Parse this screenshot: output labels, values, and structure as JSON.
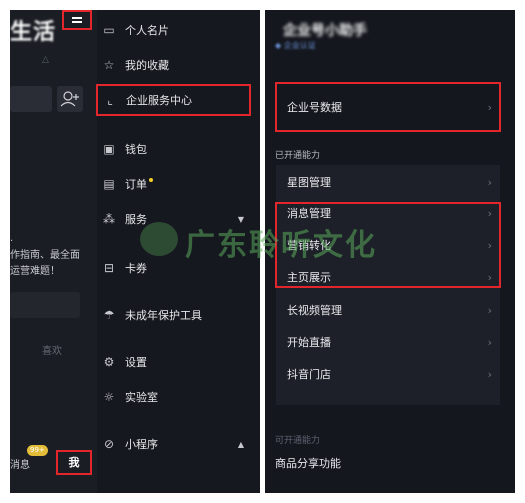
{
  "left_strip": {
    "big_title": "生活",
    "tip_line1": "作指南、最全面",
    "tip_line2": "运营难题！",
    "favorites_tab": "喜欢",
    "badge": "99+",
    "messages_tab": "消息",
    "me_tab": "我"
  },
  "menu": {
    "items": [
      {
        "icon": "id-card-icon",
        "label": "个人名片"
      },
      {
        "icon": "star-icon",
        "label": "我的收藏"
      },
      {
        "icon": "chart-icon",
        "label": "企业服务中心"
      },
      {
        "icon": "wallet-icon",
        "label": "钱包"
      },
      {
        "icon": "order-icon",
        "label": "订单"
      },
      {
        "icon": "services-icon",
        "label": "服务"
      },
      {
        "icon": "coupon-icon",
        "label": "卡券"
      },
      {
        "icon": "umbrella-icon",
        "label": "未成年保护工具"
      },
      {
        "icon": "settings-icon",
        "label": "设置"
      },
      {
        "icon": "bulb-icon",
        "label": "实验室"
      },
      {
        "icon": "mini-program-icon",
        "label": "小程序"
      }
    ]
  },
  "right": {
    "enterprise_data": "企业号数据",
    "enabled_section": "已开通能力",
    "capabilities": [
      "星图管理",
      "消息管理",
      "营销转化",
      "主页展示",
      "长视频管理",
      "开始直播",
      "抖音门店"
    ],
    "available_section": "可开通能力",
    "product_share": "商品分享功能"
  },
  "watermark": "广东聆听文化",
  "colors": {
    "highlight": "#e2262b",
    "panel_bg": "#16181f",
    "notice_dot": "#f5d02a"
  }
}
